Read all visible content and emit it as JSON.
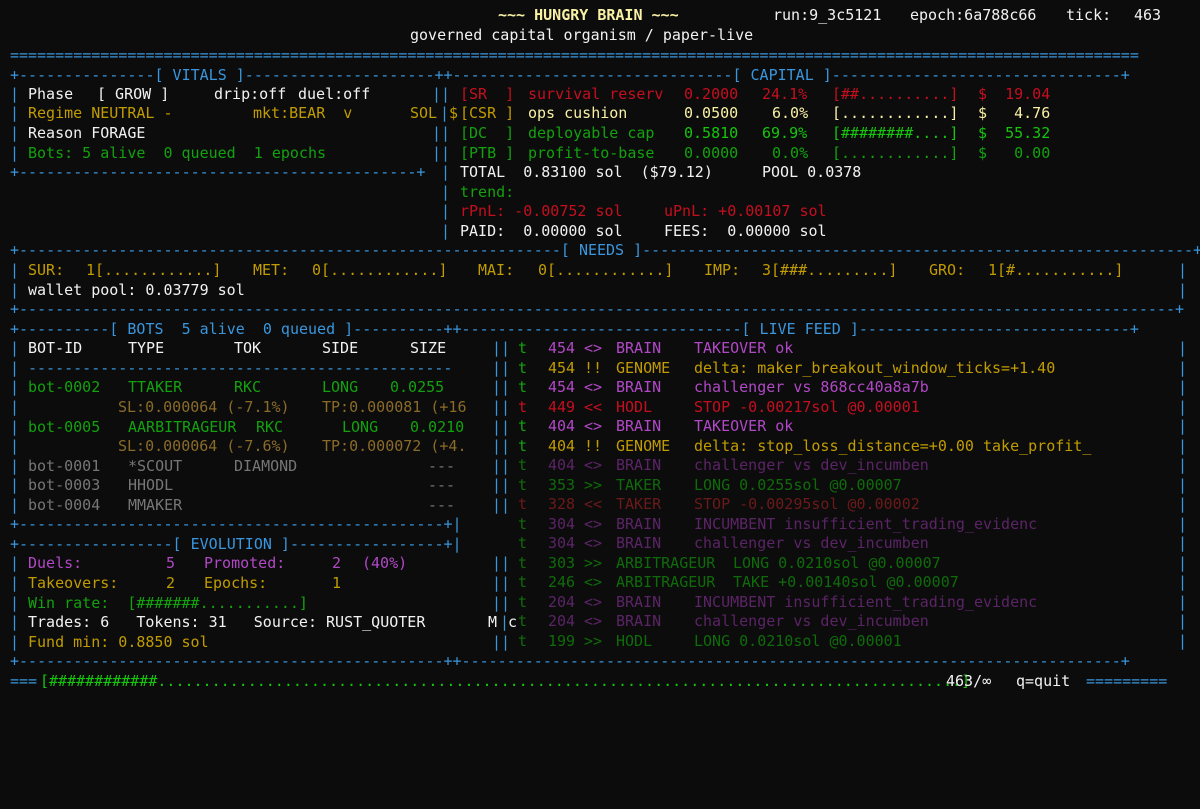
{
  "header": {
    "title": "~~~ HUNGRY BRAIN ~~~",
    "run": "run:9_3c5121",
    "epoch": "epoch:6a788c66",
    "tick_label": "tick:",
    "tick_value": "463",
    "subtitle": "governed capital organism / paper-live"
  },
  "vitals": {
    "title": "[ VITALS ]",
    "phase_label": "Phase",
    "phase_value": "[ GROW ]",
    "drip": "drip:off",
    "duel": "duel:off",
    "regime": "Regime NEUTRAL -",
    "mkt": "mkt:BEAR  v",
    "sol": "SOL",
    "reason": "Reason FORAGE",
    "bots": "Bots: 5 alive  0 queued  1 epochs"
  },
  "capital": {
    "title": "[ CAPITAL ]",
    "dollar_prefix": "$",
    "rows": [
      {
        "code": "[SR  ]",
        "name": "survival reserv",
        "value": "0.2000",
        "pct": "24.1%",
        "bar": "[##..........]",
        "usd": "$  19.04"
      },
      {
        "code": "[CSR ]",
        "name": "ops cushion",
        "value": "0.0500",
        "pct": "6.0%",
        "bar": "[............]",
        "usd": "$   4.76"
      },
      {
        "code": "[DC  ]",
        "name": "deployable cap",
        "value": "0.5810",
        "pct": "69.9%",
        "bar": "[########....]",
        "usd": "$  55.32"
      },
      {
        "code": "[PTB ]",
        "name": "profit-to-base",
        "value": "0.0000",
        "pct": "0.0%",
        "bar": "[............]",
        "usd": "$   0.00"
      }
    ],
    "total": "TOTAL  0.83100 sol  ($79.12)",
    "pool": "POOL 0.0378",
    "trend": "trend:",
    "rpnl": "rPnL: -0.00752 sol",
    "upnl": "uPnL: +0.00107 sol",
    "paid": "PAID:  0.00000 sol",
    "fees": "FEES:  0.00000 sol"
  },
  "needs": {
    "title": "[ NEEDS ]",
    "items": [
      {
        "label": "SUR:",
        "value": "1[............]"
      },
      {
        "label": "MET:",
        "value": "0[............]"
      },
      {
        "label": "MAI:",
        "value": "0[............]"
      },
      {
        "label": "IMP:",
        "value": "3[###.........]"
      },
      {
        "label": "GRO:",
        "value": "1[#...........]"
      }
    ],
    "wallet": "wallet pool: 0.03779 sol"
  },
  "bots": {
    "title": "[ BOTS  5 alive  0 queued ]",
    "headers": [
      "BOT-ID",
      "TYPE",
      "TOK",
      "SIDE",
      "SIZE"
    ],
    "active": [
      {
        "id": "bot-0002",
        "type": "TTAKER",
        "tok": "RKC",
        "side": "LONG",
        "size": "0.0255",
        "sl": "SL:0.000064 (-7.1%)",
        "tp": "TP:0.000081 (+16"
      },
      {
        "id": "bot-0005",
        "type": "AARBITRAGEUR",
        "tok": "RKC",
        "side": "LONG",
        "size": "0.0210",
        "sl": "SL:0.000064 (-7.6%)",
        "tp": "TP:0.000072 (+4."
      }
    ],
    "idle": [
      {
        "id": "bot-0001",
        "type": "*SCOUT",
        "tok": "DIAMOND",
        "side": "",
        "size": "---"
      },
      {
        "id": "bot-0003",
        "type": "HHODL",
        "tok": "",
        "side": "",
        "size": "---"
      },
      {
        "id": "bot-0004",
        "type": "MMAKER",
        "tok": "",
        "side": "",
        "size": "---"
      }
    ]
  },
  "evolution": {
    "title": "[ EVOLUTION ]",
    "duels_label": "Duels:",
    "duels_value": "5",
    "promoted_label": "Promoted:",
    "promoted_value": "2",
    "promoted_pct": "(40%)",
    "takeovers_label": "Takeovers:",
    "takeovers_value": "2",
    "epochs_label": "Epochs:",
    "epochs_value": "1",
    "winrate": "Win rate:  [#######...........]",
    "trades": "Trades: 6   Tokens: 31   Source: RUST_QUOTER",
    "overflow": "M",
    "fund": "Fund min: 0.8850 sol"
  },
  "feed": {
    "title": "[ LIVE FEED ]",
    "rows": [
      {
        "t": "t",
        "tick": "454",
        "op": "<>",
        "src": "BRAIN",
        "msg": "TAKEOVER ok"
      },
      {
        "t": "t",
        "tick": "454",
        "op": "!!",
        "src": "GENOME",
        "msg": "delta: maker_breakout_window_ticks=+1.40"
      },
      {
        "t": "t",
        "tick": "454",
        "op": "<>",
        "src": "BRAIN",
        "msg": "challenger vs 868cc40a8a7b"
      },
      {
        "t": "t",
        "tick": "449",
        "op": "<<",
        "src": "HODL",
        "msg": "STOP -0.00217sol @0.00001"
      },
      {
        "t": "t",
        "tick": "404",
        "op": "<>",
        "src": "BRAIN",
        "msg": "TAKEOVER ok"
      },
      {
        "t": "t",
        "tick": "404",
        "op": "!!",
        "src": "GENOME",
        "msg": "delta: stop_loss_distance=+0.00 take_profit_"
      },
      {
        "t": "t",
        "tick": "404",
        "op": "<>",
        "src": "BRAIN",
        "msg": "challenger vs dev_incumben"
      },
      {
        "t": "t",
        "tick": "353",
        "op": ">>",
        "src": "TAKER",
        "msg": "LONG 0.0255sol @0.00007"
      },
      {
        "t": "t",
        "tick": "328",
        "op": "<<",
        "src": "TAKER",
        "msg": "STOP -0.00295sol @0.00002"
      },
      {
        "t": "t",
        "tick": "304",
        "op": "<>",
        "src": "BRAIN",
        "msg": "INCUMBENT insufficient_trading_evidenc"
      },
      {
        "t": "t",
        "tick": "304",
        "op": "<>",
        "src": "BRAIN",
        "msg": "challenger vs dev_incumben"
      },
      {
        "t": "t",
        "tick": "303",
        "op": ">>",
        "src": "ARBITRAGEUR",
        "msg": "LONG 0.0210sol @0.00007"
      },
      {
        "t": "t",
        "tick": "246",
        "op": "<>",
        "src": "ARBITRAGEUR",
        "msg": "TAKE +0.00140sol @0.00007"
      },
      {
        "t": "t",
        "tick": "204",
        "op": "<>",
        "src": "BRAIN",
        "msg": "INCUMBENT insufficient_trading_evidenc"
      },
      {
        "t": "t",
        "tick": "204",
        "op": "<>",
        "src": "BRAIN",
        "msg": "challenger vs dev_incumben"
      },
      {
        "t": "t",
        "tick": "199",
        "op": ">>",
        "src": "HODL",
        "msg": "LONG 0.0210sol @0.00001"
      }
    ]
  },
  "footer": {
    "progress_bar": "[############.........................................................................................]",
    "counter": "463/∞",
    "quit": "q=quit"
  }
}
